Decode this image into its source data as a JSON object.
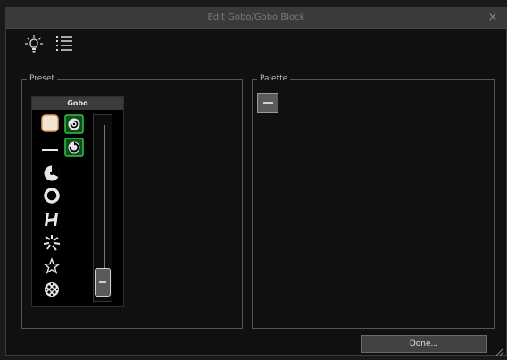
{
  "window": {
    "title": "Edit Gobo/Gobo Block",
    "close_glyph": "×"
  },
  "toolbar": {
    "icons": [
      "lightbulb-icon",
      "list-icon"
    ]
  },
  "preset_group": {
    "label": "Preset",
    "gobo_panel": {
      "header": "Gobo",
      "icons": [
        "open-white-gobo",
        "line-gobo",
        "fan-gobo",
        "ring-gobo",
        "h-shape-gobo",
        "burst-gobo",
        "star-gobo",
        "dots-gobo",
        "spiral-gobo",
        "rotate-gobo"
      ],
      "selected_icons": [
        "spiral-gobo",
        "rotate-gobo"
      ]
    },
    "slider": {
      "level_fraction": 0.08
    }
  },
  "palette_group": {
    "label": "Palette",
    "swatch": "line-icon"
  },
  "footer": {
    "done_label": "Done..."
  },
  "colors": {
    "titlebar": "#3a3a3a",
    "background": "#101010",
    "selected_border": "#33c04a",
    "selected_fill": "#0f4f1d",
    "button": "#424242"
  }
}
